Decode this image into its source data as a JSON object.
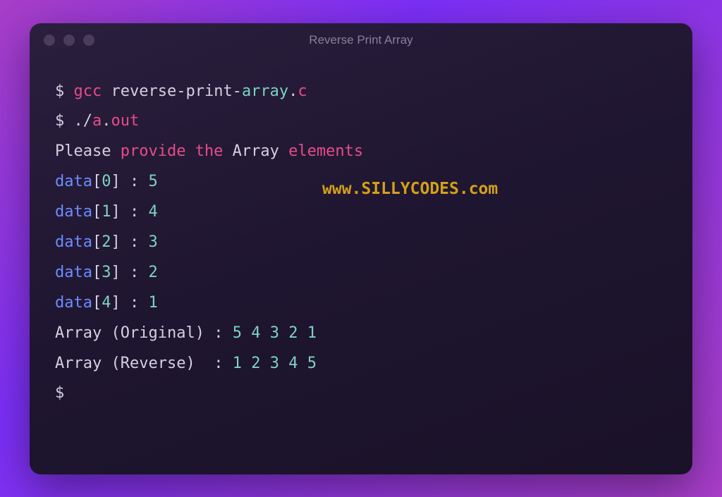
{
  "window": {
    "title": "Reverse Print Array"
  },
  "terminal": {
    "line1": {
      "prompt": "$ ",
      "gcc": "gcc",
      "sp1": " ",
      "file1": "reverse-print-",
      "array": "array",
      "dot": ".",
      "ext": "c"
    },
    "line2": {
      "prompt": "$ ",
      "dot": ".",
      "slash": "/",
      "a": "a",
      "dot2": ".",
      "out": "out"
    },
    "line3": {
      "please": "Please ",
      "provide": "provide ",
      "the": "the ",
      "array": "Array ",
      "elements": "elements"
    },
    "data": [
      {
        "label": "data",
        "lb": "[",
        "idx": "0",
        "rb": "]",
        "colon": " : ",
        "val": "5"
      },
      {
        "label": "data",
        "lb": "[",
        "idx": "1",
        "rb": "]",
        "colon": " : ",
        "val": "4"
      },
      {
        "label": "data",
        "lb": "[",
        "idx": "2",
        "rb": "]",
        "colon": " : ",
        "val": "3"
      },
      {
        "label": "data",
        "lb": "[",
        "idx": "3",
        "rb": "]",
        "colon": " : ",
        "val": "2"
      },
      {
        "label": "data",
        "lb": "[",
        "idx": "4",
        "rb": "]",
        "colon": " : ",
        "val": "1"
      }
    ],
    "original": {
      "label": "Array ",
      "lp": "(",
      "name": "Original",
      "rp": ")",
      "sep": " : ",
      "v1": "5",
      "v2": "4",
      "v3": "3",
      "v4": "2",
      "v5": "1"
    },
    "reverse": {
      "label": "Array ",
      "lp": "(",
      "name": "Reverse",
      "rp": ")",
      "sep": "  : ",
      "v1": "1",
      "v2": "2",
      "v3": "3",
      "v4": "4",
      "v5": "5"
    },
    "endprompt": "$"
  },
  "watermark": "www.SILLYCODES.com"
}
